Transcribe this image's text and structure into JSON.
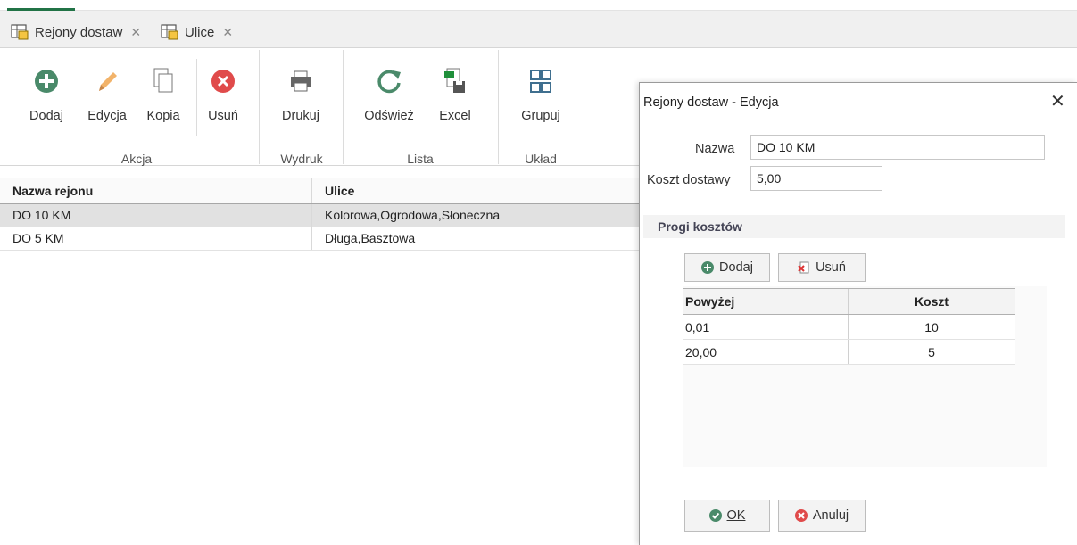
{
  "tabs": [
    {
      "label": "Rejony dostaw",
      "close": "✕"
    },
    {
      "label": "Ulice",
      "close": "✕"
    }
  ],
  "ribbon": {
    "buttons": {
      "add": "Dodaj",
      "edit": "Edycja",
      "copy": "Kopia",
      "delete": "Usuń",
      "print": "Drukuj",
      "refresh": "Odśwież",
      "excel": "Excel",
      "group": "Grupuj"
    },
    "groups": {
      "action": "Akcja",
      "printout": "Wydruk",
      "list": "Lista",
      "layout": "Układ"
    }
  },
  "grid": {
    "columns": [
      "Nazwa rejonu",
      "Ulice"
    ],
    "rows": [
      {
        "name": "DO 10 KM",
        "streets": "Kolorowa,Ogrodowa,Słoneczna"
      },
      {
        "name": "DO 5 KM",
        "streets": "Długa,Basztowa"
      }
    ]
  },
  "dialog": {
    "title": "Rejony dostaw - Edycja",
    "close": "✕",
    "name_label": "Nazwa",
    "name_value": "DO 10 KM",
    "cost_label": "Koszt dostawy",
    "cost_value": "5,00",
    "section_title": "Progi kosztów",
    "add_button": "Dodaj",
    "delete_button": "Usuń",
    "thresholds": {
      "columns": [
        "Powyżej",
        "Koszt"
      ],
      "rows": [
        {
          "above": "0,01",
          "cost": "10"
        },
        {
          "above": "20,00",
          "cost": "5"
        }
      ]
    },
    "ok_button": "OK",
    "cancel_button": "Anuluj"
  },
  "colors": {
    "accent": "#217346",
    "add_green": "#4a8a6a",
    "delete_red": "#e04b4b",
    "selected_row": "#e1e1e1"
  }
}
